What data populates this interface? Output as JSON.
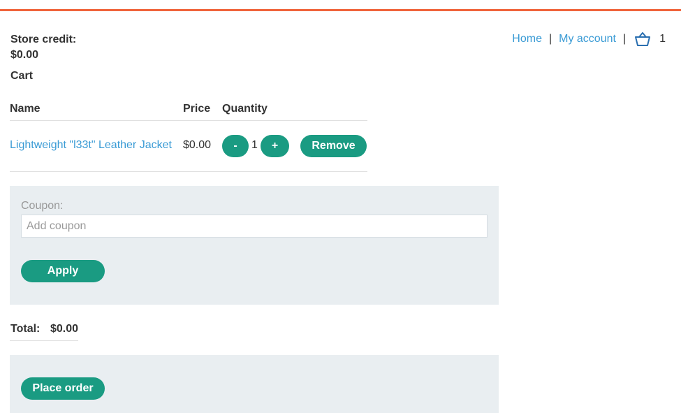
{
  "colors": {
    "accent_bar": "#f0643c",
    "button": "#1a9b82",
    "link": "#3a9bd5",
    "panel": "#e9eef1"
  },
  "store_credit": {
    "label": "Store credit:",
    "value": "$0.00"
  },
  "nav": {
    "home": "Home",
    "separator": "|",
    "account": "My account",
    "cart_icon": "basket-icon",
    "cart_count": "1"
  },
  "cart": {
    "heading": "Cart",
    "columns": [
      "Name",
      "Price",
      "Quantity"
    ],
    "items": [
      {
        "name": "Lightweight \"l33t\" Leather Jacket",
        "price": "$0.00",
        "decrement_label": "-",
        "quantity": "1",
        "increment_label": "+",
        "remove_label": "Remove"
      }
    ]
  },
  "coupon": {
    "label": "Coupon:",
    "placeholder": "Add coupon",
    "value": "",
    "apply_label": "Apply"
  },
  "total": {
    "label": "Total:",
    "value": "$0.00"
  },
  "order": {
    "place_label": "Place order"
  }
}
